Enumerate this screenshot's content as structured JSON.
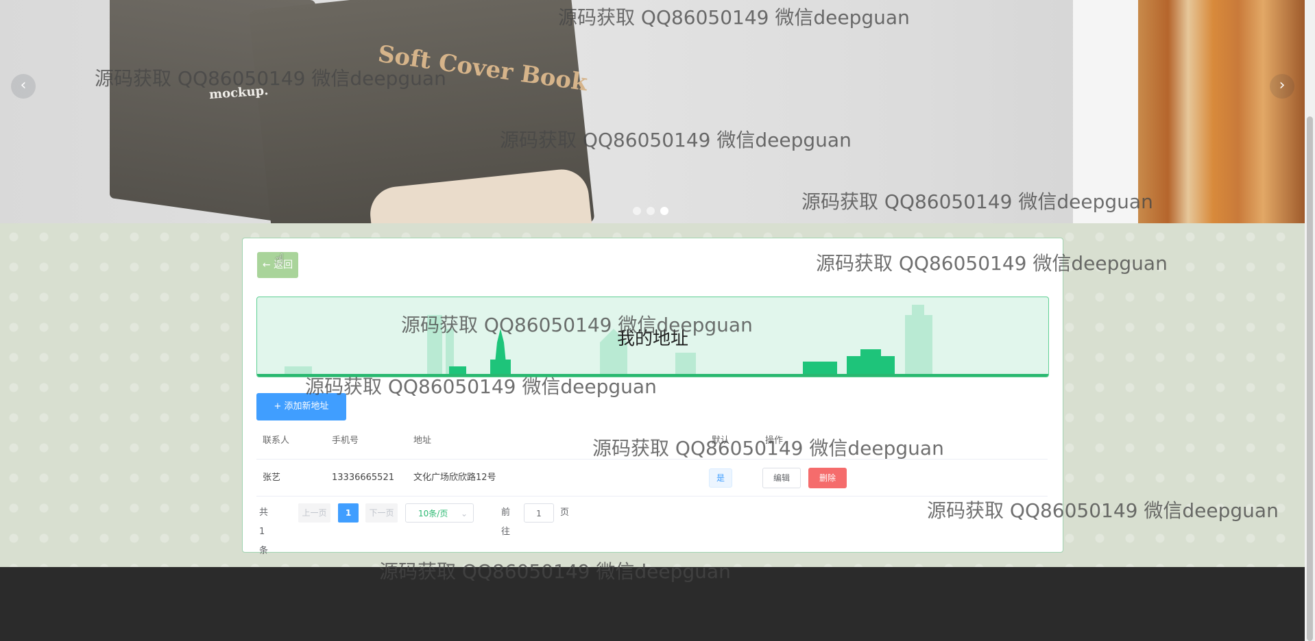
{
  "banner": {
    "book_title": "Soft Cover Book",
    "book_subtitle": "mockup.",
    "prev_arrow": "‹",
    "next_arrow": "›",
    "dots": 3,
    "active_dot": 3
  },
  "card": {
    "back_label": "← 返回",
    "page_title": "我的地址",
    "add_label": "添加新地址",
    "add_icon": "plus-icon",
    "columns": [
      "联系人",
      "手机号",
      "地址",
      "默认",
      "操作"
    ],
    "rows": [
      {
        "contact": "张艺",
        "phone": "13336665521",
        "address": "文化广场欣欣路12号",
        "default": "是",
        "edit": "编辑",
        "delete": "删除"
      }
    ]
  },
  "pagination": {
    "total": "共 1 条",
    "prev": "上一页",
    "current": "1",
    "next": "下一页",
    "page_size": "10条/页",
    "goto_prefix": "前往",
    "goto_value": "1",
    "goto_suffix": "页"
  },
  "watermark": "源码获取 QQ86050149 微信deepguan",
  "colors": {
    "primary": "#409eff",
    "danger": "#f56c6c",
    "accent_green": "#29b870",
    "back_button": "#a9d49a",
    "footer": "#2b2b2b"
  }
}
